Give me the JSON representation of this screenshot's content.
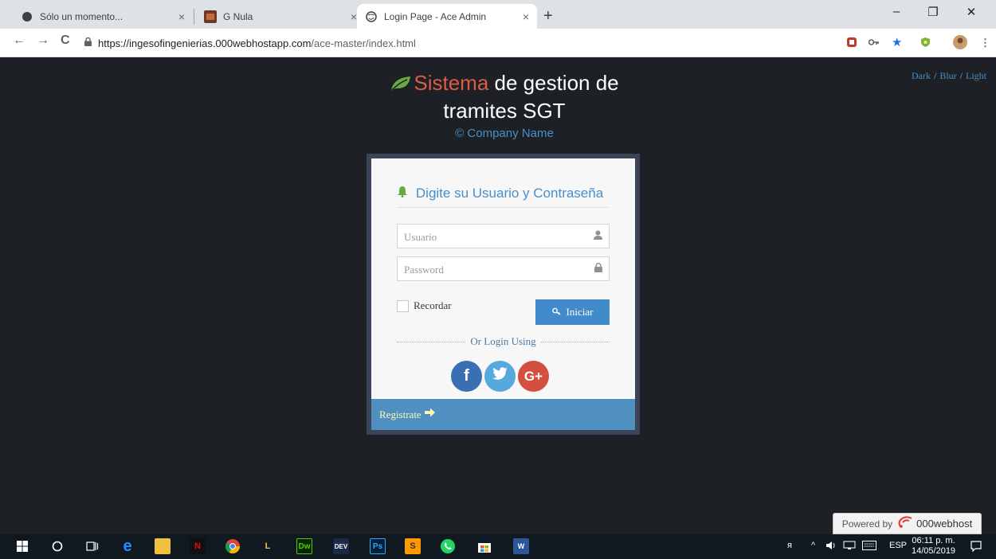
{
  "browser": {
    "tabs": [
      {
        "title": "Sólo un momento...",
        "close": "×"
      },
      {
        "title": "G Nula",
        "close": "×"
      },
      {
        "title": "Login Page - Ace Admin",
        "close": "×",
        "active": true
      }
    ],
    "new_tab": "+",
    "window_controls": {
      "minimize": "–",
      "restore": "❐",
      "close": "✕"
    },
    "nav": {
      "back": "←",
      "forward": "→",
      "reload": "C"
    },
    "url_host": "https://ingesofingenierias.000webhostapp.com",
    "url_path": "/ace-master/index.html",
    "toolbar_icons": [
      "extension-icon",
      "key-icon",
      "star-icon",
      "shield-icon",
      "profile-icon",
      "menu-icon"
    ]
  },
  "page": {
    "title_highlight": "Sistema",
    "title_rest": " de gestion de tramites SGT",
    "company": "© Company Name",
    "themes": {
      "dark": "Dark",
      "blur": "Blur",
      "light": "Light",
      "sep": "/"
    },
    "login": {
      "heading": "Digite su Usuario y Contraseña",
      "username_placeholder": "Usuario",
      "password_placeholder": "Password",
      "remember": "Recordar",
      "submit": "Iniciar",
      "or_login": "Or Login Using",
      "social": {
        "facebook": "f",
        "twitter": "t",
        "google": "G+"
      },
      "register": "Registrate"
    },
    "powered_by": "Powered by",
    "powered_brand": "000webhost"
  },
  "taskbar": {
    "tray_lang": "ESP",
    "time": "06:11 p. m.",
    "date": "14/05/2019"
  },
  "colors": {
    "page_bg": "#1d2024",
    "title_red": "#dd5a43",
    "accent_blue": "#478fca",
    "leaf_green": "#69aa46",
    "login_border": "#394557",
    "register_bar": "#5090c1",
    "facebook": "#3b6fb4",
    "twitter": "#56a9dd",
    "google": "#d34f3e"
  }
}
